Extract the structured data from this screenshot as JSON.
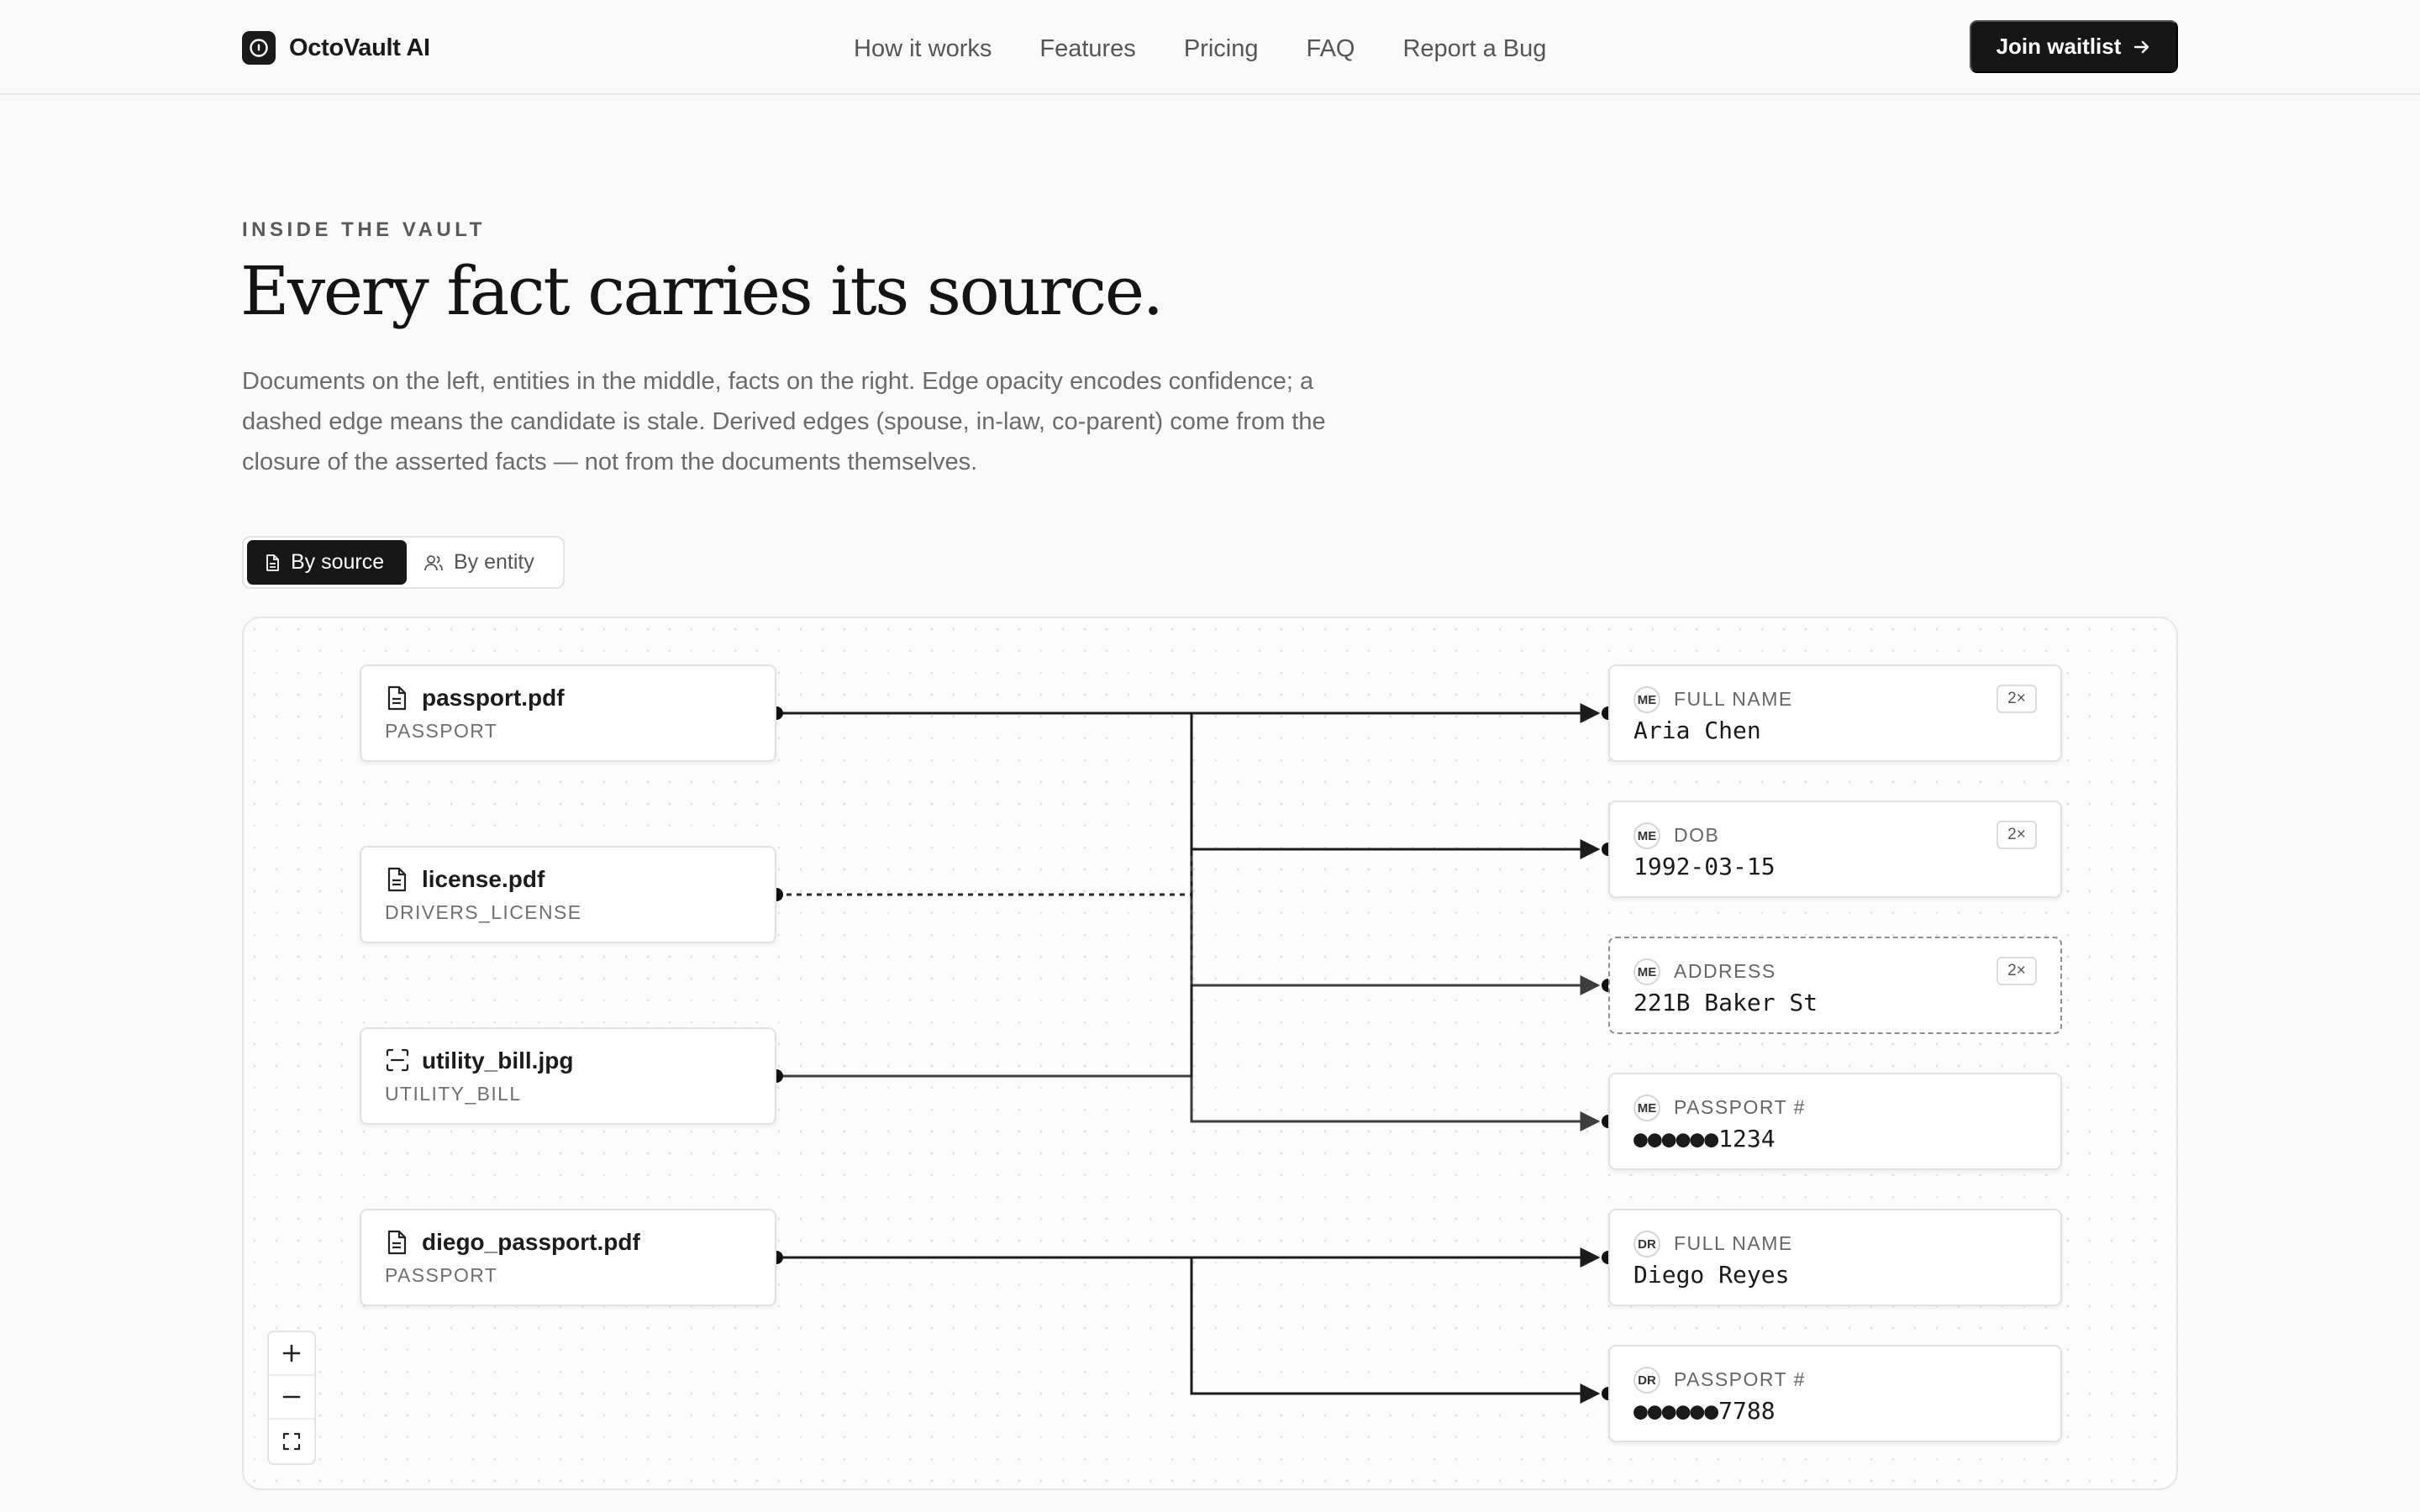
{
  "nav": {
    "brand": "OctoVault AI",
    "links": [
      "How it works",
      "Features",
      "Pricing",
      "FAQ",
      "Report a Bug"
    ],
    "cta": "Join waitlist"
  },
  "hero": {
    "eyebrow": "INSIDE THE VAULT",
    "headline": "Every fact carries its source.",
    "lede": "Documents on the left, entities in the middle, facts on the right. Edge opacity encodes confidence; a dashed edge means the candidate is stale. Derived edges (spouse, in-law, co-parent) come from the closure of the asserted facts — not from the documents themselves."
  },
  "toggle": {
    "by_source": "By source",
    "by_entity": "By entity",
    "active": "by_source"
  },
  "graph": {
    "sources": [
      {
        "name": "passport.pdf",
        "type": "PASSPORT",
        "icon": "document-icon"
      },
      {
        "name": "license.pdf",
        "type": "DRIVERS_LICENSE",
        "icon": "document-icon"
      },
      {
        "name": "utility_bill.jpg",
        "type": "UTILITY_BILL",
        "icon": "scan-icon"
      },
      {
        "name": "diego_passport.pdf",
        "type": "PASSPORT",
        "icon": "document-icon"
      }
    ],
    "facts": [
      {
        "entity": "ME",
        "label": "FULL NAME",
        "value": "Aria Chen",
        "count": "2×",
        "stale": false
      },
      {
        "entity": "ME",
        "label": "DOB",
        "value": "1992-03-15",
        "count": "2×",
        "stale": false
      },
      {
        "entity": "ME",
        "label": "ADDRESS",
        "value": "221B Baker St",
        "count": "2×",
        "stale": true
      },
      {
        "entity": "ME",
        "label": "PASSPORT #",
        "value": "●●●●●●1234",
        "count": "",
        "stale": false
      },
      {
        "entity": "DR",
        "label": "FULL NAME",
        "value": "Diego Reyes",
        "count": "",
        "stale": false
      },
      {
        "entity": "DR",
        "label": "PASSPORT #",
        "value": "●●●●●●7788",
        "count": "",
        "stale": false
      }
    ]
  },
  "colors": {
    "ink": "#171717",
    "edge": "#1c1c1c",
    "muted": "#6b6b6b",
    "background": "#fafafa"
  }
}
